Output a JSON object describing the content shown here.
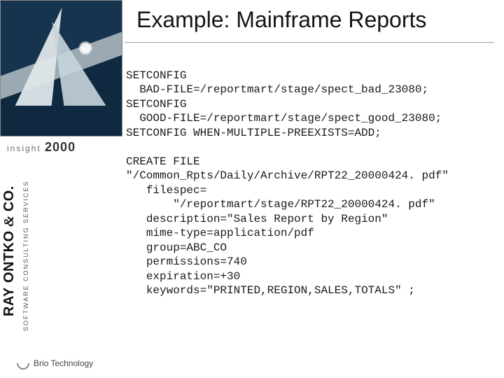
{
  "title": "Example: Mainframe Reports",
  "left": {
    "insight_label": "insight",
    "insight_year": "2000",
    "company_name": "RAY ONTKO & CO.",
    "company_tagline": "SOFTWARE CONSULTING SERVICES",
    "footer_brand": "Brio Technology"
  },
  "code": "SETCONFIG\n  BAD-FILE=/reportmart/stage/spect_bad_23080;\nSETCONFIG\n  GOOD-FILE=/reportmart/stage/spect_good_23080;\nSETCONFIG WHEN-MULTIPLE-PREEXISTS=ADD;\n\nCREATE FILE\n\"/Common_Rpts/Daily/Archive/RPT22_20000424. pdf\"\n   filespec=\n       \"/reportmart/stage/RPT22_20000424. pdf\"\n   description=\"Sales Report by Region\"\n   mime-type=application/pdf\n   group=ABC_CO\n   permissions=740\n   expiration=+30\n   keywords=\"PRINTED,REGION,SALES,TOTALS\" ;"
}
